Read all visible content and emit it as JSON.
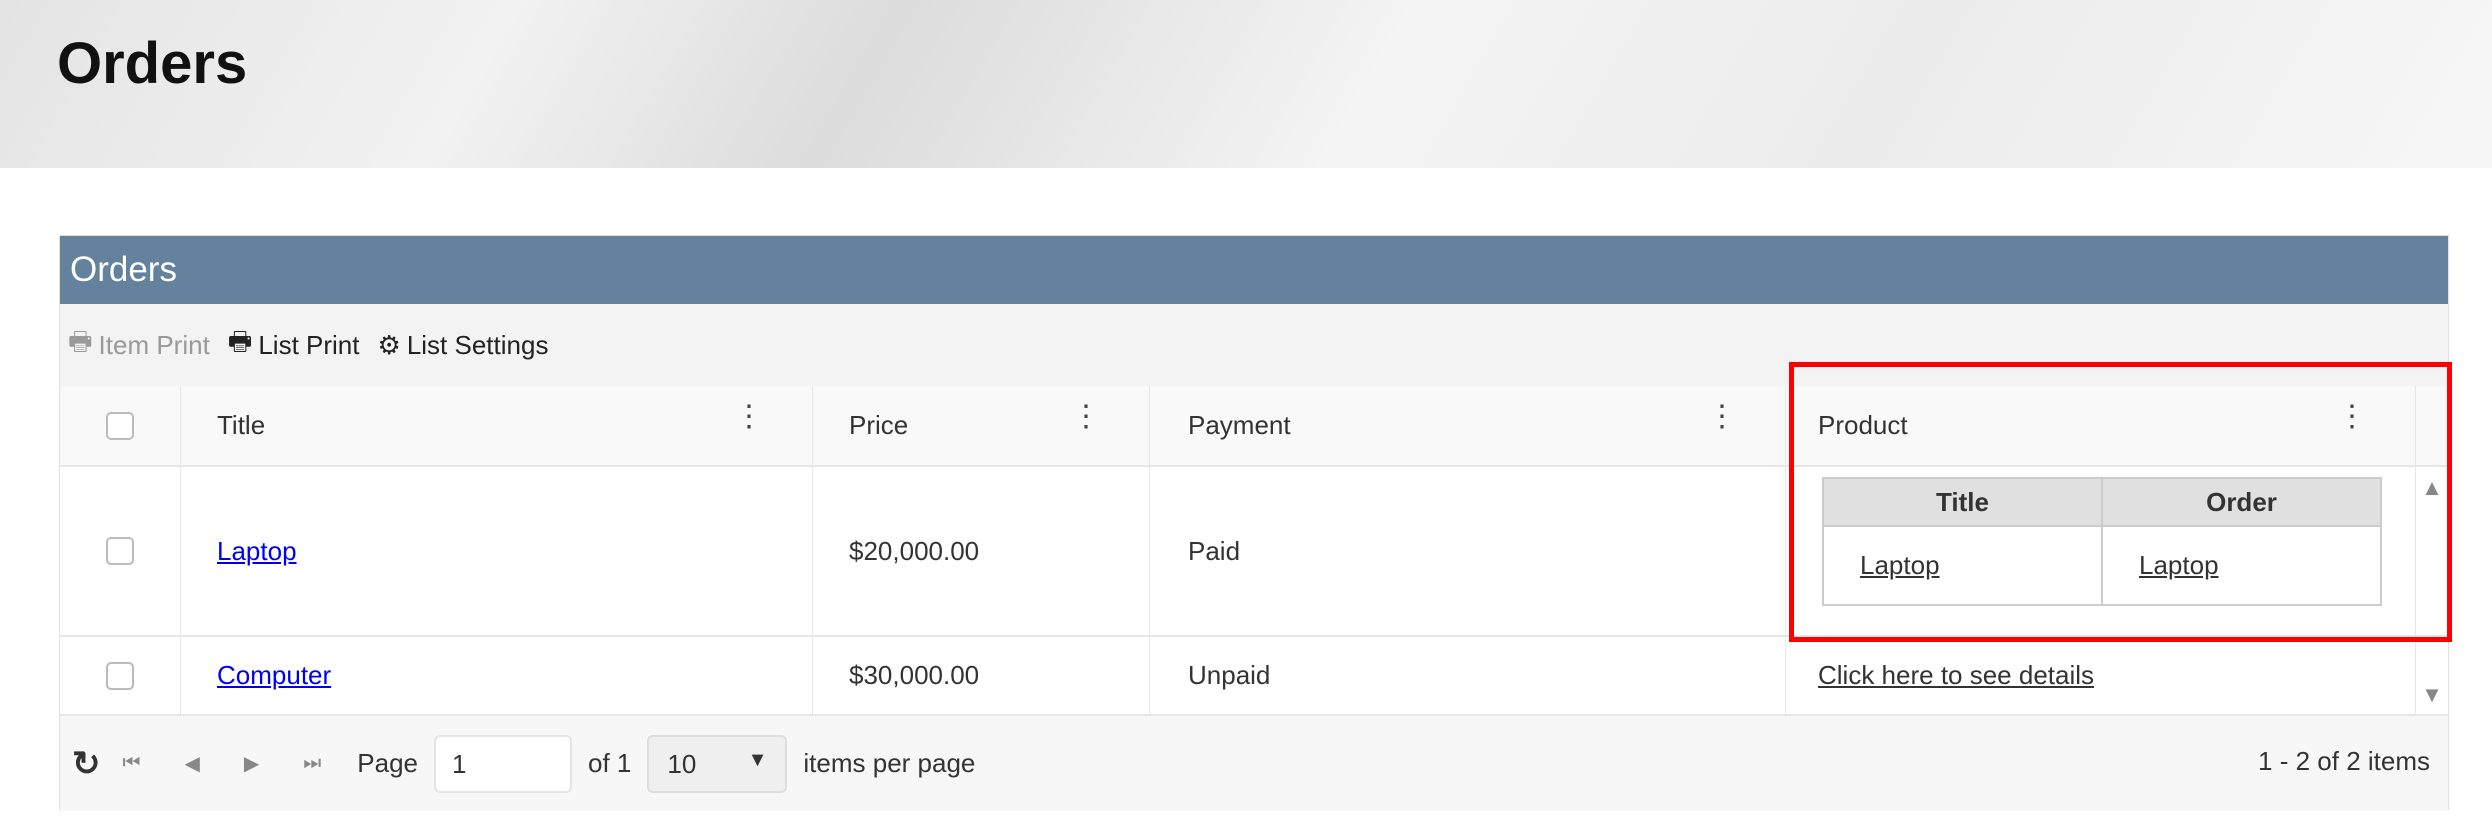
{
  "page": {
    "title": "Orders"
  },
  "panel": {
    "title": "Orders"
  },
  "toolbar": {
    "item_print": "Item Print",
    "list_print": "List Print",
    "list_settings": "List Settings"
  },
  "columns": [
    "Title",
    "Price",
    "Payment",
    "Product"
  ],
  "rows": [
    {
      "title": "Laptop",
      "price": "$20,000.00",
      "payment": "Paid",
      "product": {
        "headers": [
          "Title",
          "Order"
        ],
        "cells": [
          "Laptop",
          "Laptop"
        ]
      }
    },
    {
      "title": "Computer",
      "price": "$30,000.00",
      "payment": "Unpaid",
      "product_link": "Click here to see details"
    }
  ],
  "pager": {
    "page_label": "Page",
    "page_value": "1",
    "of_label": "of 1",
    "page_size": "10",
    "per_page_label": "items per page",
    "info": "1 - 2 of 2 items"
  },
  "highlight_color": "#ff0000",
  "accent": "#64829d"
}
